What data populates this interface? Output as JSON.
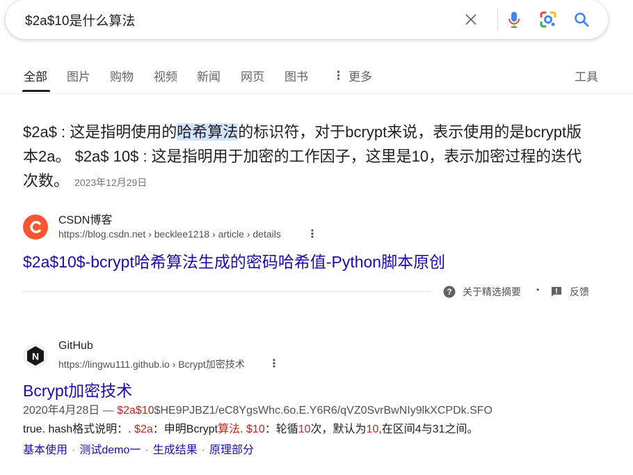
{
  "search": {
    "query": "$2a$10是什么算法"
  },
  "tabs": [
    "全部",
    "图片",
    "购物",
    "视频",
    "新闻",
    "网页",
    "图书",
    "更多"
  ],
  "tools_label": "工具",
  "featured": {
    "text_a": "$2a$ : 这是指明使用的",
    "text_highlight": "哈希算法",
    "text_b": "的标识符，对于bcrypt来说，表示使用的是bcrypt版本2a。 $2a$ 10$ : 这是指明用于加密的工作因子，这里是10，表示加密过程的迭代次数。",
    "date": "2023年12月29日",
    "site_name": "CSDN博客",
    "url": "https://blog.csdn.net › becklee1218 › article › details",
    "title": "$2a$10$-bcrypt哈希算法生成的密码哈希值-Python脚本原创",
    "about_label": "关于精选摘要",
    "dot": "•",
    "feedback_label": "反馈"
  },
  "result2": {
    "site_name": "GitHub",
    "url": "https://lingwu111.github.io › Bcrypt加密技术",
    "title": "Bcrypt加密技术",
    "date": "2020年4月28日 — ",
    "l1_em": "$2a$10",
    "l1_rest": "$HE9PJBZ1/eC8YgsWhc.6o.E.Y6R6/qVZ0SvrBwNIy9lkXCPDk.SFO",
    "l2_a": "true. hash格式说明：. ",
    "l2_em1": "$2a",
    "l2_b": "：申明Bcrypt",
    "l2_em2": "算法",
    "l2_c": ". ",
    "l2_em3": "$10",
    "l2_d": "：轮循",
    "l2_em4": "10",
    "l2_e": "次，默认为",
    "l2_em5": "10",
    "l2_f": ",在区间4与31之间。",
    "sitelinks": [
      "基本使用",
      "测试demo一",
      "生成结果",
      "原理部分"
    ],
    "sitelink_sep": "·"
  },
  "colors": {
    "link": "#1a0dab",
    "emphasis": "#c5221f",
    "highlight": "#d3e3fd",
    "csdn": "#fc5531",
    "github": "#181717"
  }
}
